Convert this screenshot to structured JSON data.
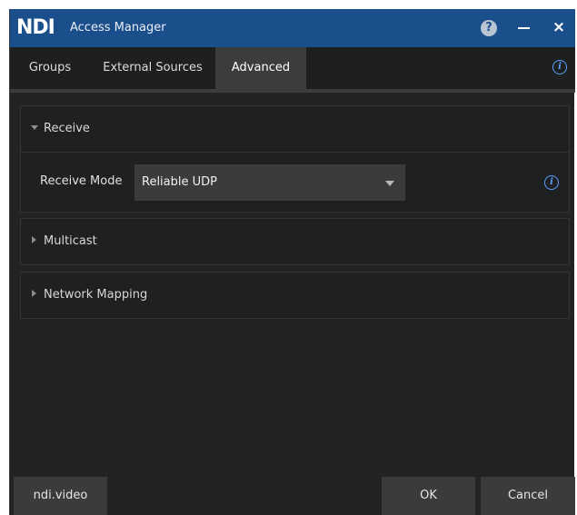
{
  "titlebar": {
    "logo": "NDI",
    "title": "Access Manager",
    "help_glyph": "?",
    "close_glyph": "×"
  },
  "tabs": [
    {
      "label": "Groups",
      "active": false
    },
    {
      "label": "External Sources",
      "active": false
    },
    {
      "label": "Advanced",
      "active": true
    }
  ],
  "info_glyph": "i",
  "sections": {
    "receive": {
      "title": "Receive",
      "expanded": true,
      "field_label": "Receive Mode",
      "field_value": "Reliable UDP"
    },
    "multicast": {
      "title": "Multicast",
      "expanded": false
    },
    "network_mapping": {
      "title": "Network Mapping",
      "expanded": false
    }
  },
  "footer": {
    "link_label": "ndi.video",
    "ok_label": "OK",
    "cancel_label": "Cancel"
  },
  "colors": {
    "titlebar": "#1b4f8c",
    "background": "#222324",
    "panel": "#1f2021",
    "control": "#3a3b3d",
    "info_accent": "#5aa0ff"
  },
  "icons": [
    "help-icon",
    "minimize-icon",
    "close-icon",
    "info-icon",
    "caret-down-icon",
    "caret-right-icon",
    "dropdown-arrow-icon"
  ]
}
